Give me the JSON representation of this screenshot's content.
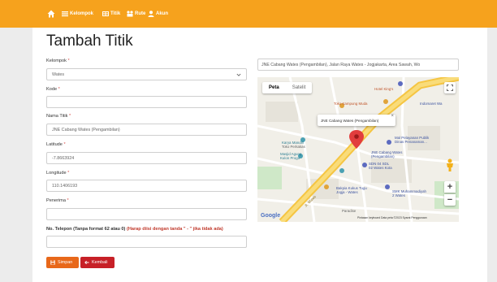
{
  "nav": {
    "items": [
      {
        "label": "Kelompok",
        "icon": "list-icon"
      },
      {
        "label": "Titik",
        "icon": "grid-icon"
      },
      {
        "label": "Rute",
        "icon": "route-icon"
      },
      {
        "label": "Akun",
        "icon": "user-icon"
      }
    ]
  },
  "page": {
    "title": "Tambah Titik"
  },
  "form": {
    "kelompok": {
      "label": "Kelompok",
      "value": "Wates"
    },
    "kode": {
      "label": "Kode",
      "value": ""
    },
    "nama_titik": {
      "label": "Nama Titik",
      "value": "JNE Cabang Wates (Pengambilan)"
    },
    "latitude": {
      "label": "Latitude",
      "value": "-7.8663924"
    },
    "longitude": {
      "label": "Longitude",
      "value": "110.1406193"
    },
    "penerima": {
      "label": "Penerima",
      "value": ""
    },
    "telepon": {
      "label": "No. Telepon (Tanpa format 62 atau 0)",
      "note": "(Harap diisi dengan tanda \" - \" jika tidak ada)",
      "value": ""
    },
    "required_mark": "*"
  },
  "buttons": {
    "save": "Simpan",
    "back": "Kembali"
  },
  "map": {
    "address": "JNE Cabang Wates (Pengambilan), Jalan Raya Wates - Jogjakarta, Area Sawah, Wo",
    "map_type_map": "Peta",
    "map_type_satellite": "Satelit",
    "info_window": "JNE Cabang Wates (Pengambilan)",
    "zoom_in": "+",
    "zoom_out": "−",
    "pois": {
      "hotel": "Hotel King's",
      "kampung_muda": "Toko Kampung Muda",
      "indomaret": "Indomaret Wa",
      "karya_mandiri": "Karya Mandiri",
      "karya_mandiri_sub": "Toko Perkakas",
      "masjid": "Masjid Agung",
      "masjid_sub": "Kulon Progo",
      "mal": "Mal Pelayanan Publik",
      "mal_sub": "Dinas Penanaman...",
      "jne": "JNE Cabang Wates",
      "jne_sub": "(Pengambilan)",
      "sdn": "SDN 04 SDL",
      "sdn_sub": "02 Wates Kota",
      "bakpia": "Bakpia Kukus Tugu",
      "bakpia_sub": "Jogja - Wates",
      "smk": "SMK Muhammadiyah",
      "smk_sub": "2 Wates",
      "road": "Jl. Wates",
      "paradise": "Paradise"
    },
    "google": "Google",
    "attribution": "Pintasan keyboard   Data peta ©2023   Syarat Penggunaan"
  }
}
